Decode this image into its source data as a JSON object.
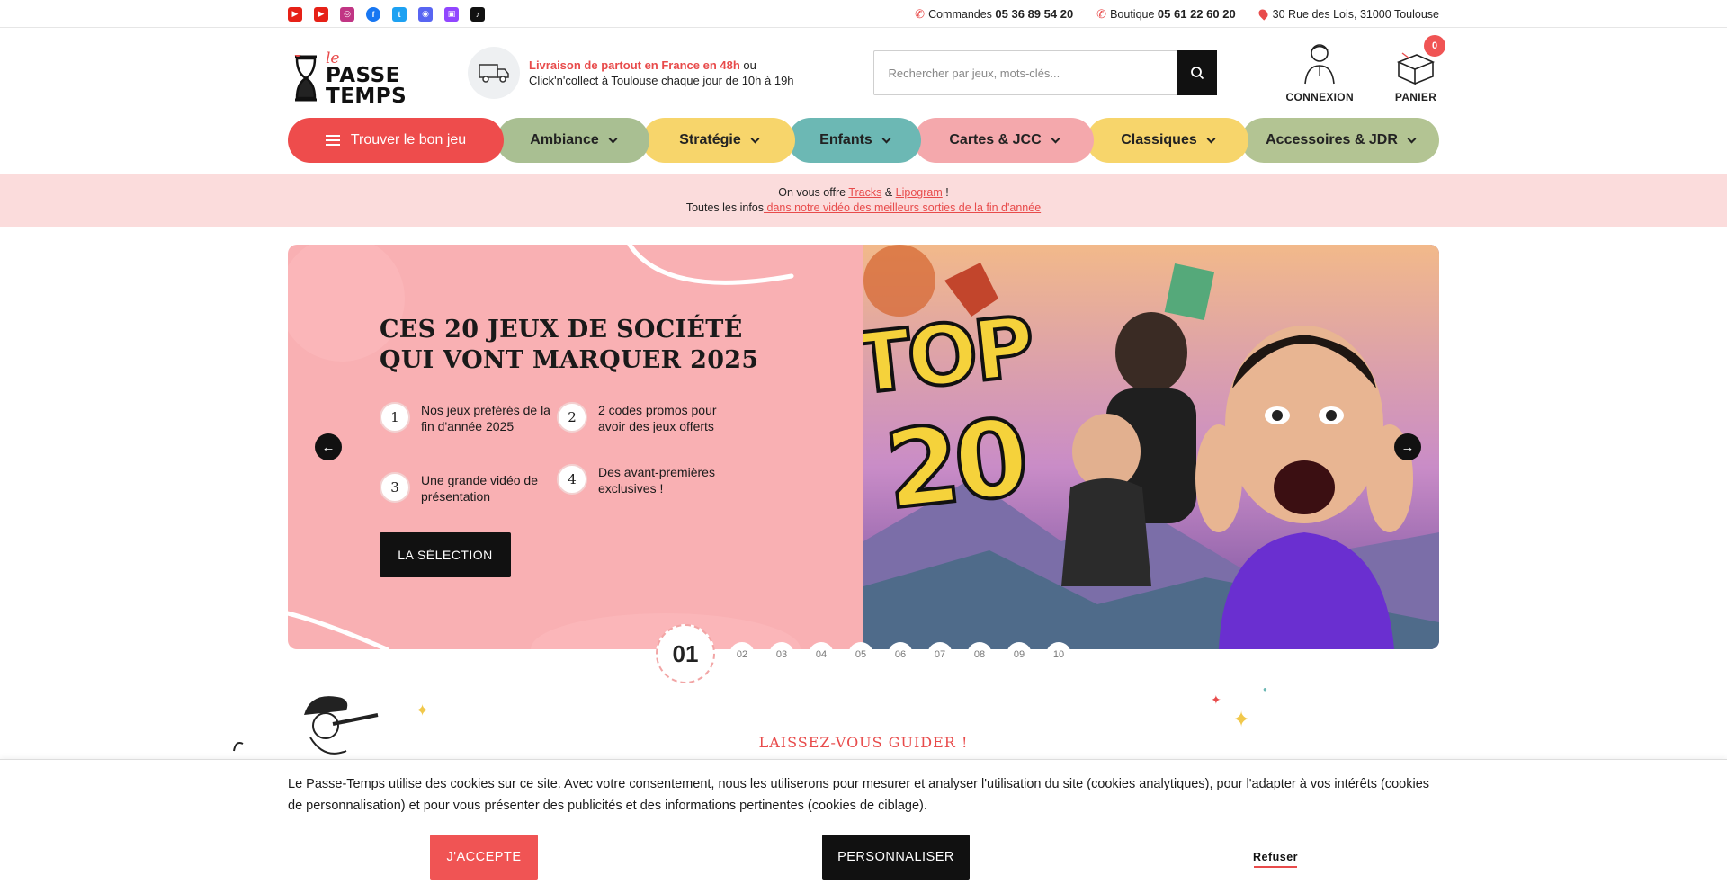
{
  "topbar": {
    "socials": [
      {
        "icon": "youtube-icon",
        "color": "#e62117"
      },
      {
        "icon": "youtube-icon",
        "color": "#e62117"
      },
      {
        "icon": "instagram-icon",
        "color": "#c13584"
      },
      {
        "icon": "facebook-icon",
        "color": "#1877f2"
      },
      {
        "icon": "twitter-icon",
        "color": "#1da1f2"
      },
      {
        "icon": "discord-icon",
        "color": "#5865f2"
      },
      {
        "icon": "twitch-icon",
        "color": "#9146ff"
      },
      {
        "icon": "tiktok-icon",
        "color": "#111111"
      }
    ],
    "orders_label": "Commandes",
    "orders_phone": "05 36 89 54 20",
    "shop_label": "Boutique",
    "shop_phone": "05 61 22 60 20",
    "address": "30 Rue des Lois, 31000 Toulouse"
  },
  "header": {
    "logo_le": "le",
    "logo_line1": "PASSE",
    "logo_line2": "TEMPS",
    "delivery_highlight": "Livraison de partout en France en 48h",
    "delivery_or": " ou",
    "delivery_line2": "Click'n'collect à Toulouse chaque jour de 10h à 19h",
    "search_placeholder": "Rechercher par jeux, mots-clés...",
    "account_label": "CONNEXION",
    "cart_label": "PANIER",
    "cart_count": "0"
  },
  "nav": {
    "find": "Trouver le bon jeu",
    "items": [
      "Ambiance",
      "Stratégie",
      "Enfants",
      "Cartes & JCC",
      "Classiques",
      "Accessoires & JDR"
    ]
  },
  "promo": {
    "line1_pre": "On vous offre ",
    "link1": "Tracks",
    "amp": " & ",
    "link2": "Lipogram",
    "line1_post": " !",
    "line2_pre": "Toutes les infos",
    "link3": " dans notre vidéo des meilleurs sorties de la fin d'année"
  },
  "hero": {
    "title_line1": "CES 20 JEUX DE SOCIÉTÉ",
    "title_line2": "QUI VONT MARQUER 2025",
    "features": [
      {
        "num": "1",
        "text": "Nos jeux préférés de la fin d'année 2025"
      },
      {
        "num": "2",
        "text": "2 codes promos pour avoir des jeux offerts"
      },
      {
        "num": "3",
        "text": "Une grande vidéo de présentation"
      },
      {
        "num": "4",
        "text": "Des avant-premières exclusives !"
      }
    ],
    "cta": "LA SÉLECTION",
    "image_top": "TOP",
    "image_num": "20",
    "slides": [
      "01",
      "02",
      "03",
      "04",
      "05",
      "06",
      "07",
      "08",
      "09",
      "10"
    ]
  },
  "guide": {
    "title": "LAISSEZ-VOUS GUIDER !"
  },
  "cookie": {
    "text": "Le Passe-Temps utilise des cookies sur ce site. Avec votre consentement, nous les utiliserons pour mesurer et analyser l'utilisation du site (cookies analytiques), pour l'adapter à vos intérêts (cookies de personnalisation) et pour vous présenter des publicités et des informations pertinentes (cookies de ciblage).",
    "accept": "J'ACCEPTE",
    "customize": "PERSONNALISER",
    "refuse": "Refuser"
  },
  "colors": {
    "brand_red": "#ee4c4c",
    "hero_pink": "#f9b0b3",
    "promo_bg": "#fbdcdc"
  }
}
